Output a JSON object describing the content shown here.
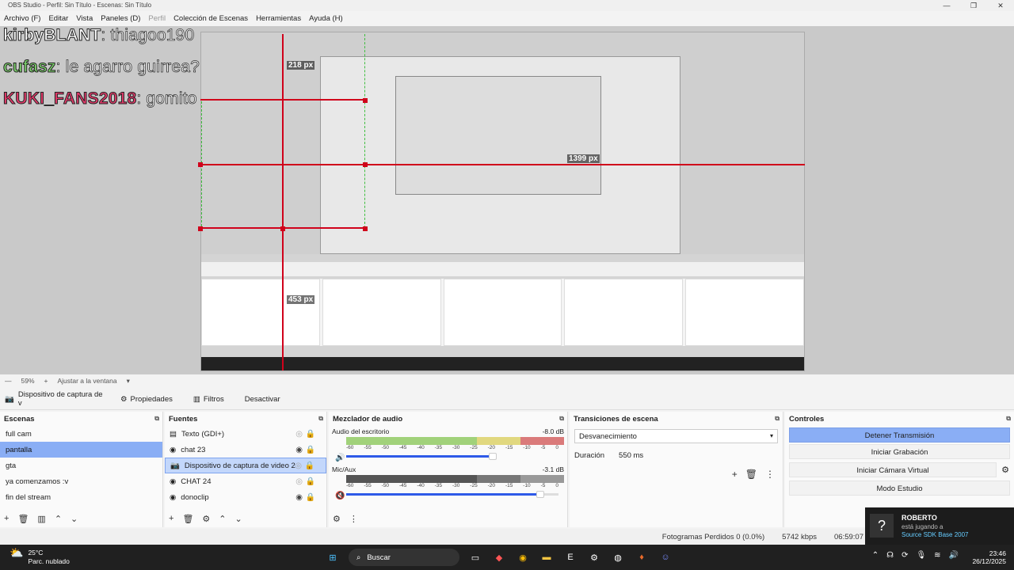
{
  "window": {
    "title": "OBS Studio - Perfil: Sin Título - Escenas: Sin Título"
  },
  "menu": [
    {
      "label": "Archivo (F)",
      "enabled": true
    },
    {
      "label": "Editar",
      "enabled": true
    },
    {
      "label": "Vista",
      "enabled": true
    },
    {
      "label": "Paneles (D)",
      "enabled": true
    },
    {
      "label": "Perfil",
      "enabled": false
    },
    {
      "label": "Colección de Escenas",
      "enabled": true
    },
    {
      "label": "Herramientas",
      "enabled": true
    },
    {
      "label": "Ayuda (H)",
      "enabled": true
    }
  ],
  "chat": [
    {
      "name": "kirbyBLANT",
      "message": ": thiagoo190",
      "color": "#ffffff"
    },
    {
      "name": "cufasz",
      "message": ": le agarro guirrea?",
      "color": "#7cd16b"
    },
    {
      "name": "KUKI_FANS2018",
      "message": ": gomito",
      "color": "#e33a6a"
    }
  ],
  "preview": {
    "px_labels": [
      "218 px",
      "453 px",
      "1399 px"
    ],
    "zoom": "59%",
    "fit_label": "Ajustar a la ventana"
  },
  "context_bar": {
    "source_name": "Dispositivo de captura de v",
    "properties": "Propiedades",
    "filters": "Filtros",
    "deactivate": "Desactivar"
  },
  "scenes": {
    "title": "Escenas",
    "items": [
      "full cam",
      "pantalla",
      "gta",
      "ya comenzamos :v",
      "fin del stream"
    ],
    "selected": 1
  },
  "sources": {
    "title": "Fuentes",
    "items": [
      {
        "label": "Texto (GDI+)",
        "icon": "text-icon",
        "visible": false
      },
      {
        "label": "chat 23",
        "icon": "browser-icon",
        "visible": true
      },
      {
        "label": "Dispositivo de captura de video 2",
        "icon": "camera-icon",
        "visible": false,
        "selected": true
      },
      {
        "label": "CHAT 24",
        "icon": "browser-icon",
        "visible": false
      },
      {
        "label": "donoclip",
        "icon": "browser-icon",
        "visible": true
      }
    ]
  },
  "mixer": {
    "title": "Mezclador de audio",
    "scale": [
      "-60",
      "-55",
      "-50",
      "-45",
      "-40",
      "-35",
      "-30",
      "-25",
      "-20",
      "-15",
      "-10",
      "-5",
      "0"
    ],
    "channels": [
      {
        "name": "Audio del escritorio",
        "db": "-8.0 dB",
        "volume": 0.85,
        "muted": false
      },
      {
        "name": "Mic/Aux",
        "db": "-3.1 dB",
        "volume": 0.92,
        "muted": true
      }
    ]
  },
  "transitions": {
    "title": "Transiciones de escena",
    "selected": "Desvanecimiento",
    "duration_label": "Duración",
    "duration_value": "550 ms"
  },
  "controls": {
    "title": "Controles",
    "stop_stream": "Detener Transmisión",
    "start_recording": "Iniciar Grabación",
    "start_virtual_cam": "Iniciar Cámara Virtual",
    "studio_mode": "Modo Estudio"
  },
  "status": {
    "dropped_frames": "Fotogramas Perdidos 0 (0.0%)",
    "bitrate": "5742 kbps",
    "time": "06:59:07"
  },
  "notification": {
    "name": "ROBERTO",
    "line": "está jugando a",
    "game": "Source SDK Base 2007"
  },
  "taskbar": {
    "temp": "25°C",
    "weather": "Parc. nublado",
    "search": "Buscar",
    "time": "23:46",
    "date": "26/12/2025"
  }
}
